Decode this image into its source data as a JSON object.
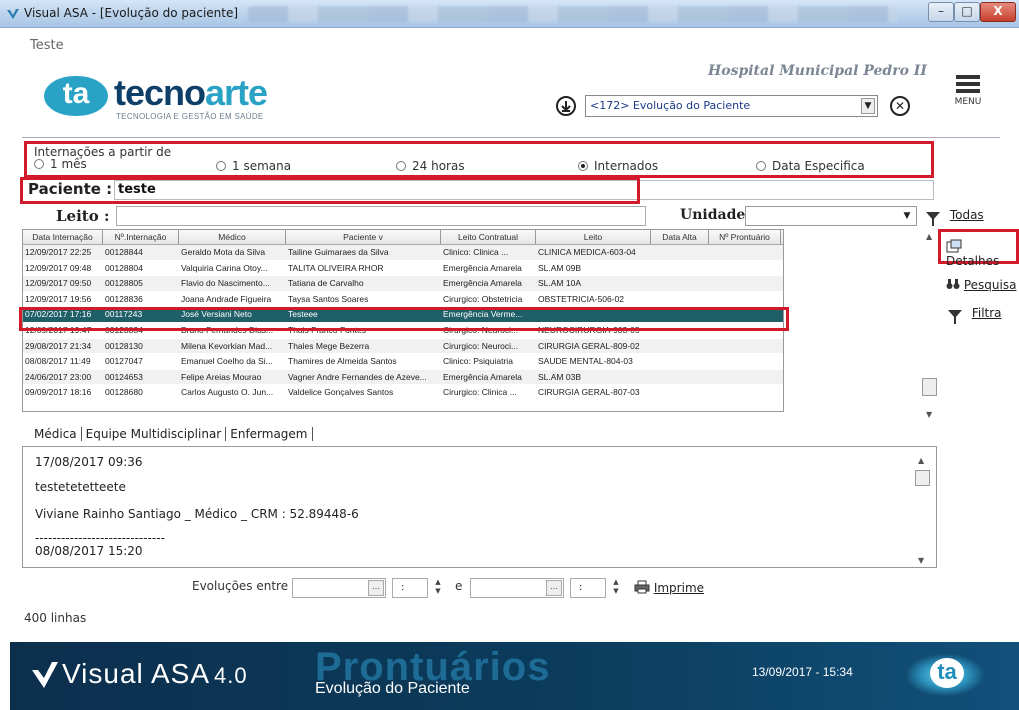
{
  "window": {
    "title": "Visual ASA - [Evolução do paciente]",
    "label": "Teste",
    "min_glyph": "–",
    "max_glyph": "□",
    "close_glyph": "X"
  },
  "header": {
    "logo_ta": "ta",
    "logo_name_a": "tecno",
    "logo_name_b": "arte",
    "logo_subtitle": "TECNOLOGIA E GESTÃO EM SAÚDE",
    "hospital": "Hospital Municipal Pedro II",
    "module_value": "<172> Evolução do Paciente",
    "menu_label": "MENU"
  },
  "filters": {
    "legend": "Internações a partir de",
    "options": [
      {
        "label": "1 mês",
        "selected": false
      },
      {
        "label": "1 semana",
        "selected": false
      },
      {
        "label": "24 horas",
        "selected": false
      },
      {
        "label": "Internados",
        "selected": true
      },
      {
        "label": "Data Especifica",
        "selected": false
      }
    ],
    "paciente_label": "Paciente :",
    "paciente_value": "teste",
    "leito_label": "Leito :",
    "leito_value": "",
    "unidade_label": "Unidade :",
    "unidade_value": "",
    "todas_label": "Todas"
  },
  "side_actions": {
    "detalhes": "Detalhes",
    "pesquisa": "Pesquisa",
    "filtra": "Filtra"
  },
  "table": {
    "columns": [
      "Data Internação",
      "Nº.Internação",
      "Médico",
      "Paciente v",
      "Leito Contratual",
      "Leito",
      "Data Alta",
      "Nº Prontuário"
    ],
    "rows": [
      [
        "12/09/2017 22:25",
        "00128844",
        "Geraldo Mota da Silva",
        "Tailine Guimaraes da Silva",
        "Clinico: Clinica ...",
        "CLINICA MEDICA-603-04",
        "",
        ""
      ],
      [
        "12/09/2017 09:48",
        "00128804",
        "Valquiria Carina Otoy...",
        "TALITA OLIVEIRA RHOR",
        "Emergência Amarela",
        "SL.AM 09B",
        "",
        ""
      ],
      [
        "12/09/2017 09:50",
        "00128805",
        "Flavio do Nascimento...",
        "Tatiana de Carvalho",
        "Emergência Amarela",
        "SL.AM 10A",
        "",
        ""
      ],
      [
        "12/09/2017 19:56",
        "00128836",
        "Joana Andrade Figueira",
        "Taysa Santos Soares",
        "Cirurgico: Obstetricia",
        "OBSTETRICIA-506-02",
        "",
        ""
      ],
      [
        "07/02/2017 17:16",
        "00117243",
        "José Versiani Neto",
        "Testeee",
        "Emergência Verme...",
        "",
        "",
        ""
      ],
      [
        "12/09/2017 19:47",
        "00128834",
        "Bruno Fernandes Dias...",
        "Thais Franco Fontes",
        "Cirurgico: Neuroci...",
        "NEUROCIRURGIA-903-05",
        "",
        ""
      ],
      [
        "29/08/2017 21:34",
        "00128130",
        "Milena Kevorkian Mad...",
        "Thales Mege Bezerra",
        "Cirurgico: Neuroci...",
        "CIRURGIA GERAL-809-02",
        "",
        ""
      ],
      [
        "08/08/2017 11:49",
        "00127047",
        "Emanuel Coelho da Si...",
        "Thamires de Almeida Santos",
        "Clinico: Psiquiatria",
        "SAUDE MENTAL-804-03",
        "",
        ""
      ],
      [
        "24/06/2017 23:00",
        "00124653",
        "Felipe Areias Mourao",
        "Vagner Andre Fernandes de Azeve...",
        "Emergência Amarela",
        "SL.AM 03B",
        "",
        ""
      ],
      [
        "09/09/2017 18:16",
        "00128680",
        "Carlos Augusto O. Jun...",
        "Valdelice Gonçalves Santos",
        "Cirurgico: Clinica ...",
        "CIRURGIA GERAL-807-03",
        "",
        ""
      ]
    ],
    "selected_row": 4
  },
  "tabs": [
    "Médica",
    "Equipe Multidisciplinar",
    "Enfermagem"
  ],
  "notes": {
    "line1": "17/08/2017 09:36",
    "line2": "testetetetteete",
    "line3": "Viviane Rainho Santiago _ Médico _ CRM : 52.89448-6",
    "line4": "------------------------------",
    "line5": "08/08/2017 15:20"
  },
  "evolucoes": {
    "label": "Evoluções entre",
    "and": "e",
    "time_sep": ":",
    "print": "Imprime"
  },
  "status": {
    "rows_count": "400 linhas"
  },
  "footer": {
    "brand": "Visual ASA",
    "version": "4.0",
    "module": "Prontuários",
    "submodule": "Evolução do Paciente",
    "datetime": "13/09/2017 - 15:34",
    "badge": "ta"
  }
}
